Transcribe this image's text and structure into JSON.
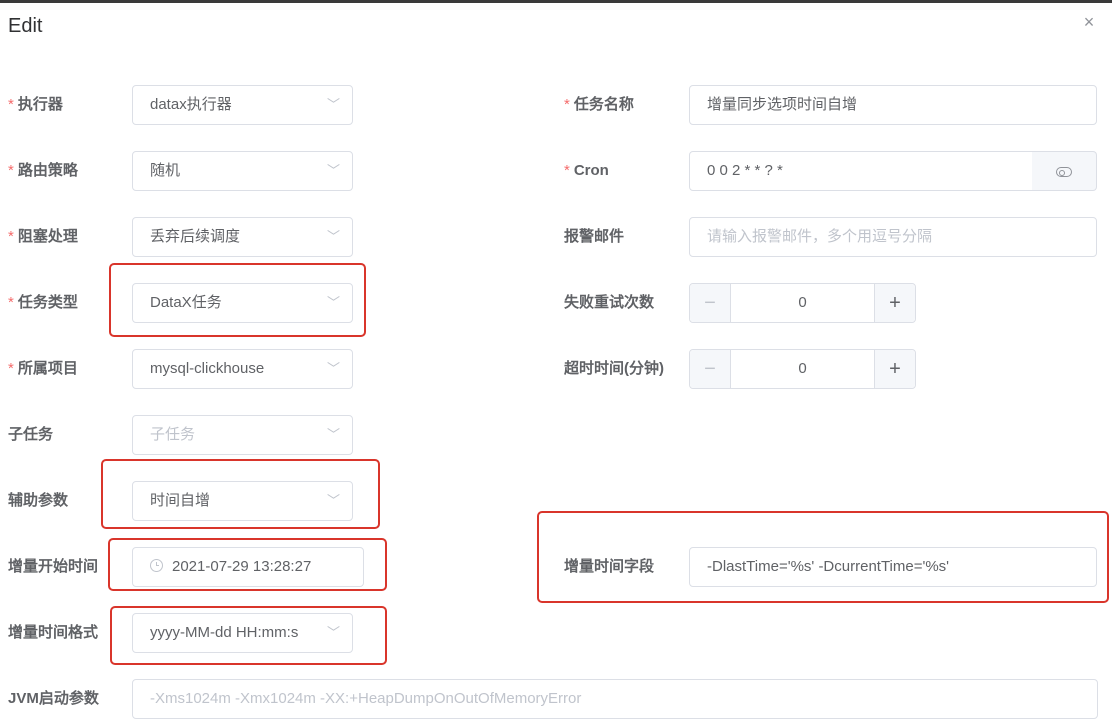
{
  "dialog": {
    "title": "Edit",
    "close_glyph": "×"
  },
  "left": {
    "executor": {
      "label": "执行器",
      "required": true,
      "value": "datax执行器"
    },
    "route": {
      "label": "路由策略",
      "required": true,
      "value": "随机"
    },
    "block": {
      "label": "阻塞处理",
      "required": true,
      "value": "丢弃后续调度"
    },
    "task_type": {
      "label": "任务类型",
      "required": true,
      "value": "DataX任务"
    },
    "project": {
      "label": "所属项目",
      "required": true,
      "value": "mysql-clickhouse"
    },
    "subtask": {
      "label": "子任务",
      "required": false,
      "placeholder": "子任务"
    },
    "aux_param": {
      "label": "辅助参数",
      "required": false,
      "value": "时间自增"
    },
    "incr_start": {
      "label": "增量开始时间",
      "required": false,
      "value": "2021-07-29 13:28:27"
    },
    "incr_format": {
      "label": "增量时间格式",
      "required": false,
      "value": "yyyy-MM-dd HH:mm:s"
    }
  },
  "right": {
    "task_name": {
      "label": "任务名称",
      "required": true,
      "value": "增量同步选项时间自增"
    },
    "cron": {
      "label": "Cron",
      "required": true,
      "value": "0 0 2 * * ? *"
    },
    "alarm_email": {
      "label": "报警邮件",
      "required": false,
      "placeholder": "请输入报警邮件，多个用逗号分隔"
    },
    "retry": {
      "label": "失败重试次数",
      "required": false,
      "value": "0"
    },
    "timeout": {
      "label": "超时时间(分钟)",
      "required": false,
      "value": "0"
    },
    "incr_field": {
      "label": "增量时间字段",
      "required": false,
      "value": "-DlastTime='%s' -DcurrentTime='%s'"
    }
  },
  "jvm": {
    "label": "JVM启动参数",
    "placeholder": "-Xms1024m -Xmx1024m -XX:+HeapDumpOnOutOfMemoryError"
  },
  "icons": {
    "chevron": "﹀",
    "minus": "−",
    "plus": "+",
    "required_mark": "*"
  },
  "colors": {
    "required": "#f56c6c",
    "highlight": "#d9352b",
    "border": "#dcdfe6"
  }
}
